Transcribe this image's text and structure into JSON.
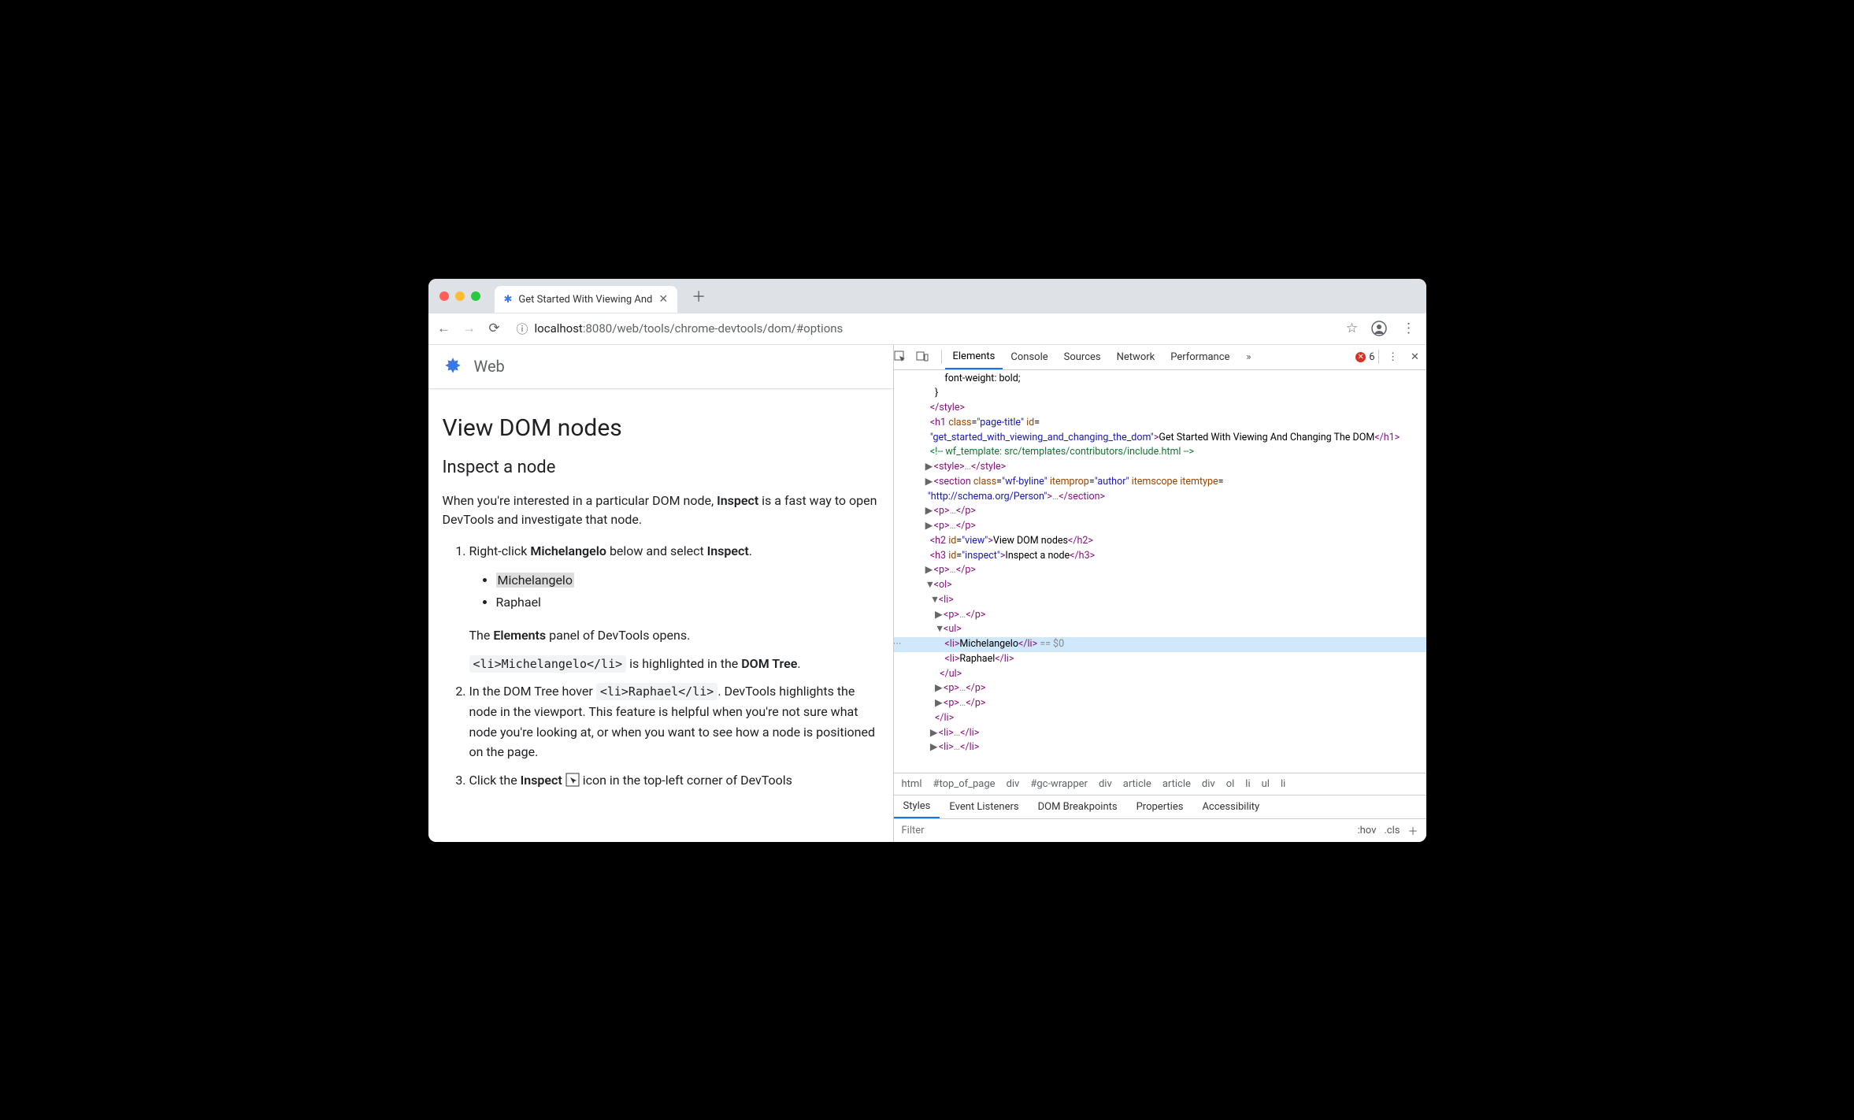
{
  "browser": {
    "tab_title": "Get Started With Viewing And",
    "url_host": "localhost",
    "url_port": ":8080",
    "url_path": "/web/tools/chrome-devtools/dom/#options"
  },
  "page": {
    "site_label": "Web",
    "heading": "View DOM nodes",
    "subheading": "Inspect a node",
    "intro_before": "When you're interested in a particular DOM node, ",
    "intro_bold": "Inspect",
    "intro_after": " is a fast way to open DevTools and investigate that node.",
    "step1_a": "Right-click ",
    "step1_b": "Michelangelo",
    "step1_c": " below and select ",
    "step1_d": "Inspect",
    "step1_e": ".",
    "list_item1": "Michelangelo",
    "list_item2": "Raphael",
    "step1_line2_a": "The ",
    "step1_line2_b": "Elements",
    "step1_line2_c": " panel of DevTools opens.",
    "step1_code": "<li>Michelangelo</li>",
    "step1_line3_a": " is highlighted in the ",
    "step1_line3_b": "DOM Tree",
    "step1_line3_c": ".",
    "step2_a": "In the DOM Tree hover ",
    "step2_code": "<li>Raphael</li>",
    "step2_b": ". DevTools highlights the node in the viewport. This feature is helpful when you're not sure what node you're looking at, or when you want to see how a node is positioned on the page.",
    "step3_a": "Click the ",
    "step3_b": "Inspect",
    "step3_c": " icon in the top-left corner of DevTools"
  },
  "devtools": {
    "tabs": [
      "Elements",
      "Console",
      "Sources",
      "Network",
      "Performance"
    ],
    "error_count": "6",
    "breadcrumb": [
      "html",
      "#top_of_page",
      "div",
      "#gc-wrapper",
      "div",
      "article",
      "article",
      "div",
      "ol",
      "li",
      "ul",
      "li"
    ],
    "subtabs": [
      "Styles",
      "Event Listeners",
      "DOM Breakpoints",
      "Properties",
      "Accessibility"
    ],
    "filter_placeholder": "Filter",
    "hov": ":hov",
    "cls": ".cls",
    "dom": {
      "l0": "font-weight: bold;",
      "l1": "}",
      "h1_class": "page-title",
      "h1_id": "get_started_with_viewing_and_changing_the_dom",
      "h1_text": "Get Started With Viewing And Changing The DOM",
      "comment": " wf_template: src/templates/contributors/include.html ",
      "section_class": "wf-byline",
      "section_itemprop": "author",
      "section_itemtype": "http://schema.org/Person",
      "h2_id": "view",
      "h2_text": "View DOM nodes",
      "h3_id": "inspect",
      "h3_text": "Inspect a node",
      "li1": "Michelangelo",
      "li2": "Raphael",
      "selected_suffix": " == $0"
    }
  }
}
